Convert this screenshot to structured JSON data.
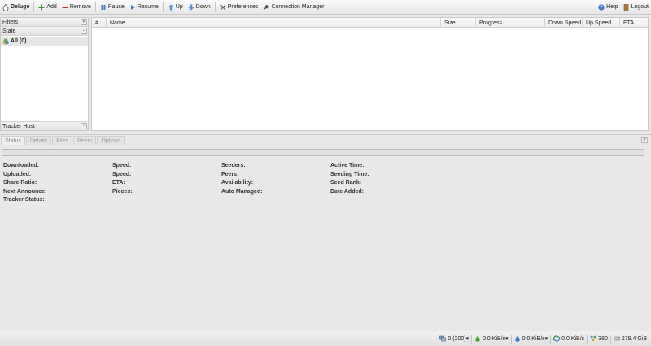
{
  "toolbar": {
    "app_title": "Deluge",
    "add": "Add",
    "remove": "Remove",
    "pause": "Pause",
    "resume": "Resume",
    "up": "Up",
    "down": "Down",
    "preferences": "Preferences",
    "connection_manager": "Connection Manager",
    "help": "Help",
    "logout": "Logout"
  },
  "sidebar": {
    "filters_title": "Filters",
    "collapse_glyph": "«",
    "state_title": "State",
    "state_toggle": "−",
    "state_items": [
      {
        "label": "All (0)"
      }
    ],
    "tracker_title": "Tracker Host",
    "tracker_toggle": "+"
  },
  "grid": {
    "columns": [
      "#",
      "Name",
      "Size",
      "Progress",
      "Down Speed",
      "Up Speed",
      "ETA"
    ]
  },
  "details": {
    "tabs": [
      "Status",
      "Details",
      "Files",
      "Peers",
      "Options"
    ],
    "active_tab": "Status",
    "collapse_glyph": "»",
    "progress_percent": 0,
    "col1": [
      "Downloaded:",
      "Uploaded:",
      "Share Ratio:",
      "Next Announce:",
      "Tracker Status:"
    ],
    "col2": [
      "Speed:",
      "Speed:",
      "ETA:",
      "Pieces:"
    ],
    "col3": [
      "Seeders:",
      "Peers:",
      "Availability:",
      "Auto Managed:"
    ],
    "col4": [
      "Active Time:",
      "Seeding Time:",
      "Seed Rank:",
      "Date Added:"
    ]
  },
  "statusbar": {
    "connections": "0 (200)",
    "download_speed": "0.0 KiB/s",
    "upload_speed": "0.0 KiB/s",
    "protocol_traffic": "0.0 KiB/s",
    "dht_nodes": "380",
    "free_space": "279.4 GiB"
  },
  "colors": {
    "toolbar_bg": "#f0f0f0",
    "panel_border": "#c9c9c9",
    "state_selected_bg": "#e7e7e7",
    "progress_fill": "#8fb9e6"
  },
  "icons": {
    "app": "deluge-drop-icon",
    "add": "plus-icon",
    "remove": "minus-icon",
    "pause": "pause-icon",
    "resume": "play-icon",
    "up": "arrow-up-icon",
    "down": "arrow-down-icon",
    "preferences": "tools-icon",
    "connection_manager": "plug-icon",
    "help": "help-icon",
    "logout": "door-icon"
  }
}
